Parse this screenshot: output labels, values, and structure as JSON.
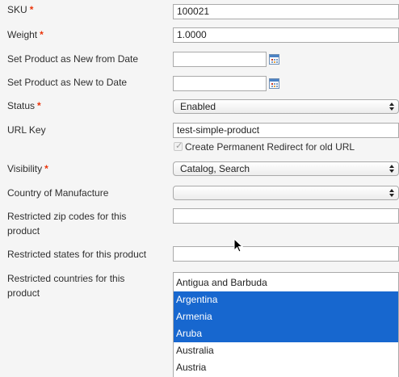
{
  "fields": {
    "sku": {
      "label": "SKU",
      "required": "*",
      "value": "100021"
    },
    "weight": {
      "label": "Weight",
      "required": "*",
      "value": "1.0000"
    },
    "new_from": {
      "label": "Set Product as New from Date",
      "value": ""
    },
    "new_to": {
      "label": "Set Product as New to Date",
      "value": ""
    },
    "status": {
      "label": "Status",
      "required": "*",
      "value": "Enabled"
    },
    "url_key": {
      "label": "URL Key",
      "value": "test-simple-product",
      "checkbox_label": "Create Permanent Redirect for old URL",
      "checkbox_checked": true
    },
    "visibility": {
      "label": "Visibility",
      "required": "*",
      "value": "Catalog, Search"
    },
    "country": {
      "label": "Country of Manufacture",
      "value": ""
    },
    "zip": {
      "label_line1": "Restricted zip codes for this",
      "label_line2": "product",
      "value": ""
    },
    "states": {
      "label": "Restricted states for this product",
      "value": ""
    },
    "countries": {
      "label_line1": "Restricted countries for this",
      "label_line2": "product",
      "options": [
        {
          "label": "Antigua and Barbuda",
          "selected": false
        },
        {
          "label": "Argentina",
          "selected": true
        },
        {
          "label": "Armenia",
          "selected": true
        },
        {
          "label": "Aruba",
          "selected": true
        },
        {
          "label": "Australia",
          "selected": false
        },
        {
          "label": "Austria",
          "selected": false
        }
      ]
    }
  },
  "colors": {
    "required": "#eb340a",
    "selection": "#1767cf"
  },
  "icons": {
    "date": "calendar-icon",
    "select": "select-arrows-icon",
    "cursor": "mouse-pointer-icon"
  }
}
